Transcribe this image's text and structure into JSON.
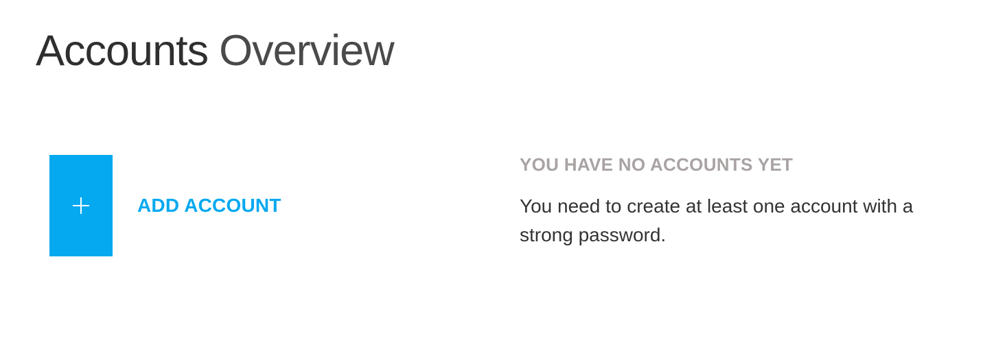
{
  "header": {
    "title_primary": "Accounts",
    "title_secondary": "Overview"
  },
  "add_account": {
    "icon": "plus-icon",
    "label": "ADD ACCOUNT",
    "accent_color": "#05a9f0"
  },
  "empty_state": {
    "heading": "YOU HAVE NO ACCOUNTS YET",
    "message": "You need to create at least one account with a strong password.",
    "heading_color": "#a9a3a3"
  }
}
